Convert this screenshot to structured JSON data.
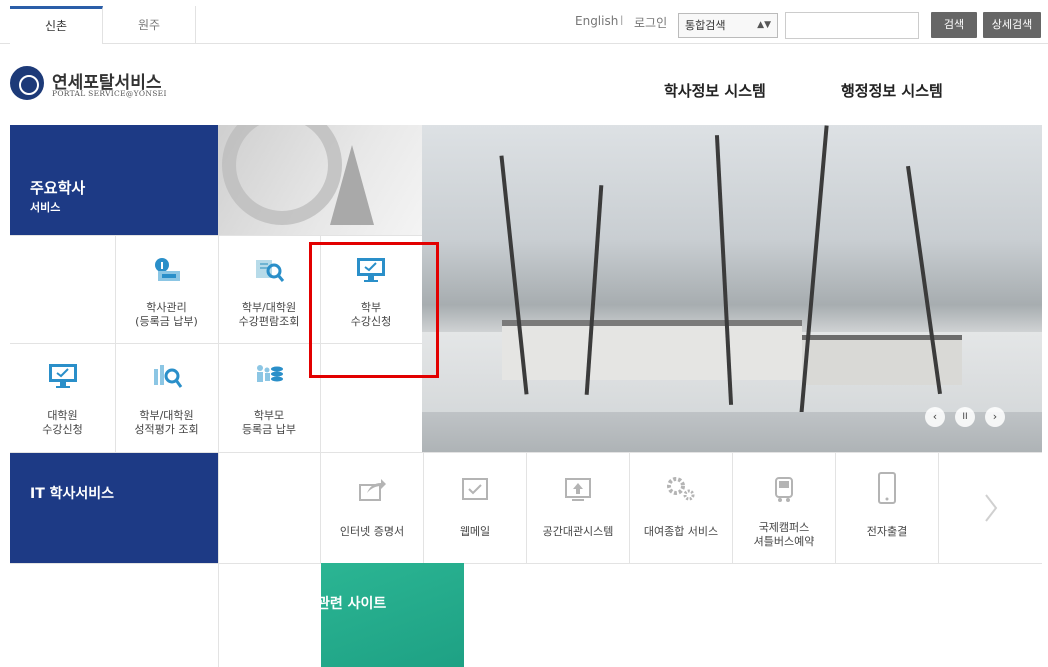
{
  "top": {
    "tabs": [
      {
        "label": "신촌"
      },
      {
        "label": "원주"
      }
    ],
    "english": "English",
    "separator": "l",
    "login": "로그인",
    "search_select": "통합검색",
    "search_value": "",
    "search_btn": "검색",
    "adv_search_btn": "상세검색"
  },
  "logo": {
    "name": "연세포탈서비스",
    "sub": "PORTAL SERVICE@YONSEI"
  },
  "gnb": [
    {
      "label": "학사정보 시스템"
    },
    {
      "label": "행정정보 시스템"
    }
  ],
  "main": {
    "title1": "주요학사",
    "title2": "서비스",
    "items": [
      {
        "label1": "학사관리",
        "label2": "(등록금 납부)",
        "icon": "info-money-icon"
      },
      {
        "label1": "학부/대학원",
        "label2": "수강편람조회",
        "icon": "book-search-icon"
      },
      {
        "label1": "학부",
        "label2": "수강신청",
        "icon": "monitor-check-icon"
      },
      {
        "label1": "대학원",
        "label2": "수강신청",
        "icon": "monitor-check-icon"
      },
      {
        "label1": "학부/대학원",
        "label2": "성적평가 조회",
        "icon": "chart-search-icon"
      },
      {
        "label1": "학부모",
        "label2": "등록금 납부",
        "icon": "parents-coins-icon"
      }
    ]
  },
  "it": {
    "title": "IT 학사서비스",
    "items": [
      {
        "label1": "인터넷 증명서",
        "label2": "",
        "icon": "share-icon"
      },
      {
        "label1": "웹메일",
        "label2": "",
        "icon": "mail-check-icon"
      },
      {
        "label1": "공간대관시스템",
        "label2": "",
        "icon": "upload-icon"
      },
      {
        "label1": "대여종합 서비스",
        "label2": "",
        "icon": "gears-icon"
      },
      {
        "label1": "국제캠퍼스",
        "label2": "셔틀버스예약",
        "icon": "bus-icon"
      },
      {
        "label1": "전자출결",
        "label2": "",
        "icon": "phone-icon"
      }
    ]
  },
  "related": {
    "title": "관련 사이트"
  },
  "hero_controls": {
    "prev": "‹",
    "pause": "II",
    "next": "›"
  },
  "colors": {
    "navy": "#1d3a85",
    "green": "#1ea184",
    "highlight": "#e20000"
  }
}
